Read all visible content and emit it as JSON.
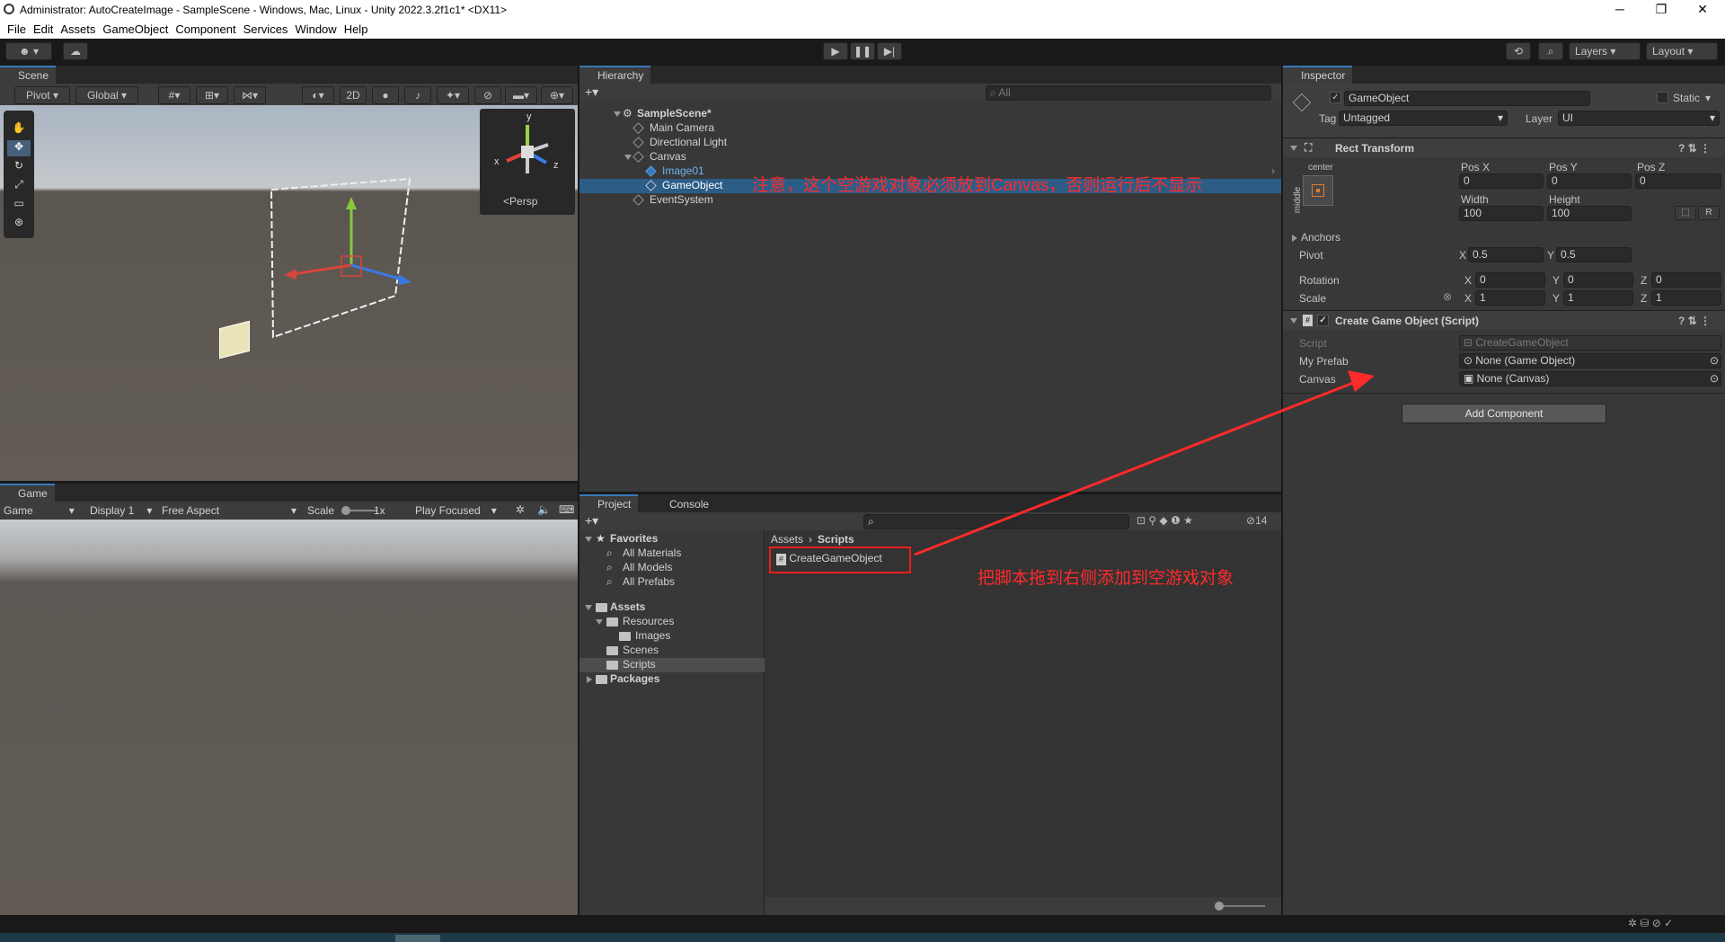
{
  "window": {
    "title": "Administrator: AutoCreateImage - SampleScene - Windows, Mac, Linux - Unity 2022.3.2f1c1* <DX11>",
    "min": "─",
    "max": "❐",
    "close": "✕"
  },
  "menu": [
    "File",
    "Edit",
    "Assets",
    "GameObject",
    "Component",
    "Services",
    "Window",
    "Help"
  ],
  "toolbar": {
    "layers": "Layers",
    "layout": "Layout"
  },
  "scene": {
    "tab": "Scene",
    "pivot": "Pivot",
    "global": "Global",
    "mode2d": "2D",
    "persp": "Persp",
    "gizmo_y": "y",
    "gizmo_x": "x",
    "gizmo_z": "z"
  },
  "game": {
    "tab": "Game",
    "mode": "Game",
    "display": "Display 1",
    "aspect": "Free Aspect",
    "scale_label": "Scale",
    "scale_value": "1x",
    "play_focused": "Play Focused"
  },
  "hierarchy": {
    "tab": "Hierarchy",
    "search_placeholder": "All",
    "items": [
      {
        "label": "SampleScene*",
        "depth": 0
      },
      {
        "label": "Main Camera",
        "depth": 1
      },
      {
        "label": "Directional Light",
        "depth": 1
      },
      {
        "label": "Canvas",
        "depth": 1
      },
      {
        "label": "Image01",
        "depth": 2
      },
      {
        "label": "GameObject",
        "depth": 2,
        "selected": true
      },
      {
        "label": "EventSystem",
        "depth": 1
      }
    ]
  },
  "project": {
    "tab_project": "Project",
    "tab_console": "Console",
    "hidden_count": "14",
    "tree": [
      {
        "label": "Favorites",
        "depth": 0
      },
      {
        "label": "All Materials",
        "depth": 1
      },
      {
        "label": "All Models",
        "depth": 1
      },
      {
        "label": "All Prefabs",
        "depth": 1
      },
      {
        "label": "Assets",
        "depth": 0
      },
      {
        "label": "Resources",
        "depth": 1
      },
      {
        "label": "Images",
        "depth": 2
      },
      {
        "label": "Scenes",
        "depth": 1
      },
      {
        "label": "Scripts",
        "depth": 1,
        "selected": true
      },
      {
        "label": "Packages",
        "depth": 0
      }
    ],
    "breadcrumb": [
      "Assets",
      "Scripts"
    ],
    "file": "CreateGameObject"
  },
  "inspector": {
    "tab": "Inspector",
    "object_name": "GameObject",
    "static": "Static",
    "tag_label": "Tag",
    "tag_value": "Untagged",
    "layer_label": "Layer",
    "layer_value": "UI",
    "rect": {
      "title": "Rect Transform",
      "anchor_h": "center",
      "anchor_v": "middle",
      "posx_label": "Pos X",
      "posy_label": "Pos Y",
      "posz_label": "Pos Z",
      "posx": "0",
      "posy": "0",
      "posz": "0",
      "width_label": "Width",
      "height_label": "Height",
      "width": "100",
      "height": "100",
      "anchors": "Anchors",
      "pivot": "Pivot",
      "pivot_x": "0.5",
      "pivot_y": "0.5",
      "rotation": "Rotation",
      "rot_x": "0",
      "rot_y": "0",
      "rot_z": "0",
      "scale": "Scale",
      "scale_x": "1",
      "scale_y": "1",
      "scale_z": "1",
      "x": "X",
      "y": "Y",
      "z": "Z",
      "r": "R"
    },
    "script": {
      "title": "Create Game Object (Script)",
      "script_label": "Script",
      "script_value": "CreateGameObject",
      "prefab_label": "My Prefab",
      "prefab_value": "None (Game Object)",
      "canvas_label": "Canvas",
      "canvas_value": "None (Canvas)"
    },
    "add_component": "Add Component"
  },
  "annotations": {
    "hierarchy_note": "注意，这个空游戏对象必须放到Canvas，否则运行后不显示",
    "project_note": "把脚本拖到右侧添加到空游戏对象",
    "color": "#ff2a2a"
  }
}
